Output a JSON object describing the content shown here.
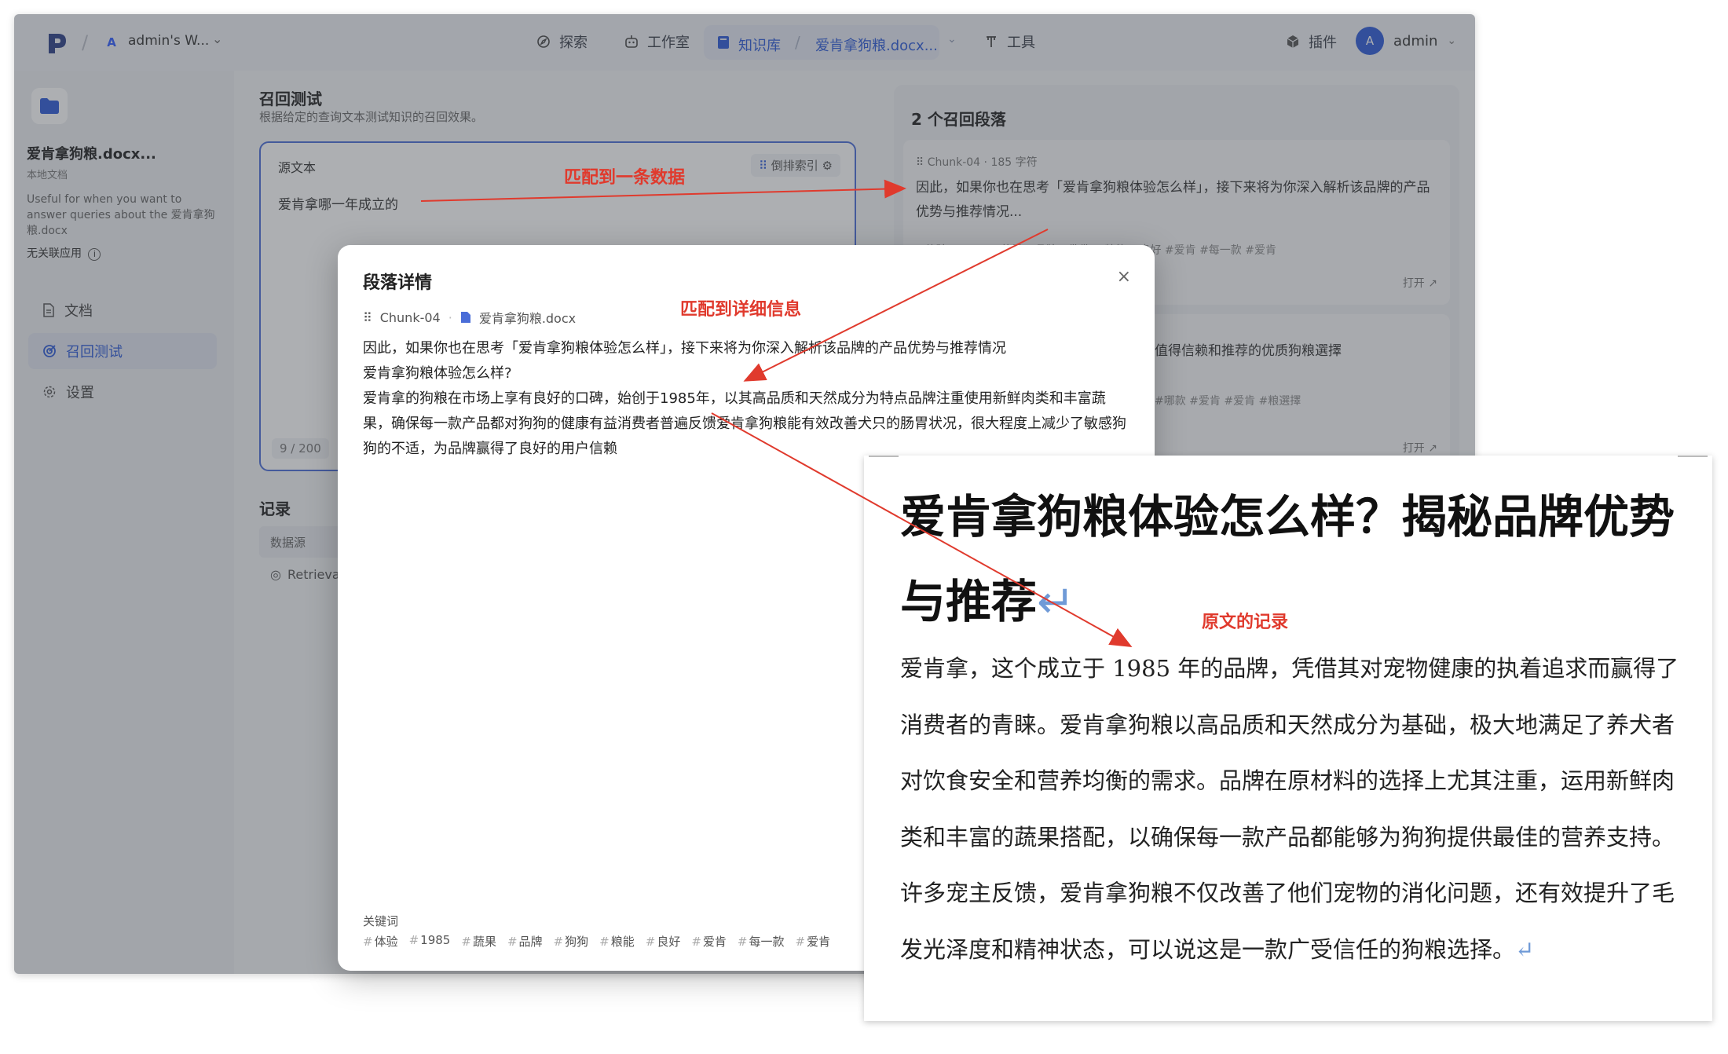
{
  "topbar": {
    "workspace_initial": "A",
    "workspace_name": "admin's W...",
    "nav": {
      "explore": "探索",
      "studio": "工作室",
      "knowledge": "知识库",
      "current_kb": "爱肯拿狗粮.docx...",
      "tools": "工具",
      "plugins": "插件"
    },
    "user_initial": "A",
    "user_name": "admin"
  },
  "sidebar": {
    "kb_name": "爱肯拿狗粮.docx...",
    "kb_type": "本地文档",
    "kb_desc": "Useful for when you want to answer queries about the 爱肯拿狗粮.docx",
    "linked_apps": "无关联应用",
    "items": [
      {
        "label": "文档"
      },
      {
        "label": "召回测试"
      },
      {
        "label": "设置"
      }
    ]
  },
  "recall": {
    "title": "召回测试",
    "subtitle": "根据给定的查询文本测试知识的召回效果。",
    "source_label": "源文本",
    "index_mode": "倒排索引",
    "query": "爱肯拿哪一年成立的",
    "char_count": "9 / 200",
    "records_title": "记录",
    "records_col": "数据源",
    "records_row": "Retrieva"
  },
  "results": {
    "title": "2 个召回段落",
    "card1": {
      "chunk": "Chunk-04",
      "chars": "185 字符",
      "text": "因此，如果你也在思考「爱肯拿狗粮体验怎么样」，接下来将为你深入解析该品牌的产品优势与推荐情况...",
      "tags": "#体验 #1985 #蔬果 #品牌 #狗狗 #粮能 #良好 #爱肯 #每一款 #爱肯",
      "open": "打开 ↗"
    },
    "card2": {
      "text": "值得信赖和推荐的优质狗粮選擇",
      "tags": "#哪款 #爱肯 #爱肯 #粮選擇",
      "open": "打开 ↗"
    }
  },
  "modal": {
    "title": "段落详情",
    "close": "×",
    "chunk": "Chunk-04",
    "file": "爱肯拿狗粮.docx",
    "line1": "因此，如果你也在思考「爱肯拿狗粮体验怎么样」，接下来将为你深入解析该品牌的产品优势与推荐情况",
    "line2": "爱肯拿狗粮体验怎么样?",
    "line3": "爱肯拿的狗粮在市场上享有良好的口碑，始创于1985年，以其高品质和天然成分为特点品牌注重使用新鲜肉类和丰富蔬果，确保每一款产品都对狗狗的健康有益消费者普遍反馈爱肯拿狗粮能有效改善犬只的肠胃状况，很大程度上减少了敏感狗狗的不适，为品牌赢得了良好的用户信赖",
    "keywords_label": "关键词",
    "keywords": [
      "体验",
      "1985",
      "蔬果",
      "品牌",
      "狗狗",
      "粮能",
      "良好",
      "爱肯",
      "每一款",
      "爱肯"
    ]
  },
  "document": {
    "title": "爱肯拿狗粮体验怎么样？揭秘品牌优势与推荐",
    "body": "爱肯拿，这个成立于 1985 年的品牌，凭借其对宠物健康的执着追求而赢得了消费者的青睐。爱肯拿狗粮以高品质和天然成分为基础，极大地满足了养犬者对饮食安全和营养均衡的需求。品牌在原材料的选择上尤其注重，运用新鲜肉类和丰富的蔬果搭配，以确保每一款产品都能够为狗狗提供最佳的营养支持。许多宠主反馈，爱肯拿狗粮不仅改善了他们宠物的消化问题，还有效提升了毛发光泽度和精神状态，可以说这是一款广受信任的狗粮选择。",
    "return_mark": "↵"
  },
  "annotations": {
    "match_one": "匹配到一条数据",
    "match_detail": "匹配到详细信息",
    "original": "原文的记录"
  },
  "colors": {
    "accent": "#2d5bd7",
    "annotation": "#e03a2d"
  }
}
